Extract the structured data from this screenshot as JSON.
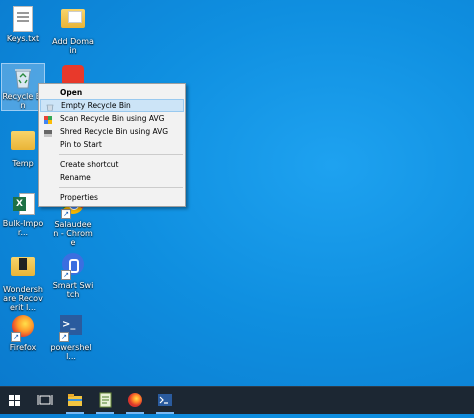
{
  "desktop": {
    "icons": [
      {
        "label": "Keys.txt"
      },
      {
        "label": "Add Domain"
      },
      {
        "label": "Recycle Bin"
      },
      {
        "label": "Temp"
      },
      {
        "label": "Bulk-Impor..."
      },
      {
        "label": "Salaudeen - Chrome"
      },
      {
        "label": "Wondershare Recoverit I..."
      },
      {
        "label": "Smart Switch"
      },
      {
        "label": "Firefox"
      },
      {
        "label": "powershell..."
      }
    ]
  },
  "context_menu": {
    "items": [
      {
        "label": "Open",
        "icon": "none"
      },
      {
        "label": "Empty Recycle Bin",
        "icon": "recycle-bin-icon"
      },
      {
        "label": "Scan Recycle Bin using AVG",
        "icon": "avg-scan-icon"
      },
      {
        "label": "Shred Recycle Bin using AVG",
        "icon": "avg-shredder-icon"
      },
      {
        "label": "Pin to Start",
        "icon": "none"
      },
      {
        "label": "Create shortcut",
        "icon": "none"
      },
      {
        "label": "Rename",
        "icon": "none"
      },
      {
        "label": "Properties",
        "icon": "none"
      }
    ]
  },
  "taskbar": {
    "items": [
      "windows-start-icon",
      "task-view-icon",
      "file-explorer-icon",
      "notepad-icon",
      "firefox-icon",
      "powershell-icon"
    ]
  },
  "colors": {
    "desktop_bg": "#0f8fe0",
    "taskbar_bg": "#1c2733",
    "menu_bg": "#f2f2f2",
    "menu_hover": "#cce4f7"
  }
}
